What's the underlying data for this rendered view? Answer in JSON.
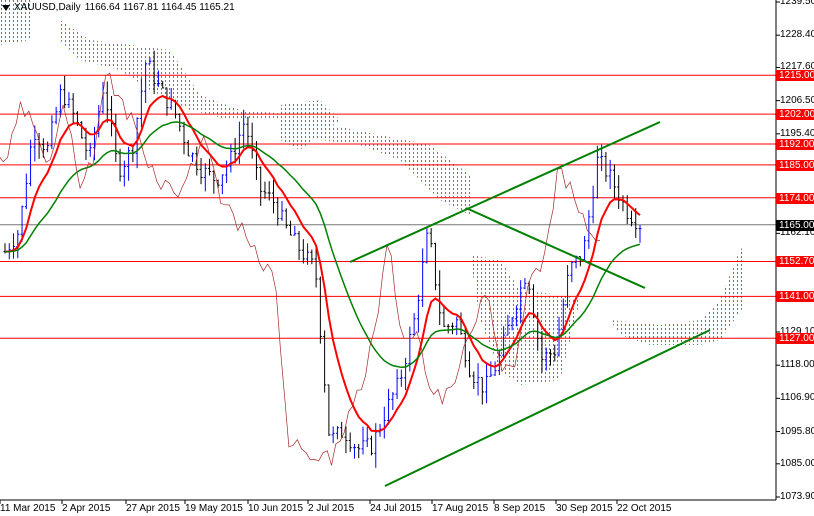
{
  "header": {
    "symbol": "XAUUSD,Daily",
    "ohlc": "1166.64 1167.81 1164.45 1165.21"
  },
  "colors": {
    "bull": "#0000ff",
    "bear": "#000000",
    "level": "#ff0000",
    "trend": "#008000",
    "kijun": "#ff0000",
    "current": "#000000"
  },
  "chart_data": {
    "type": "candlestick",
    "title": "XAUUSD,Daily",
    "ylim": [
      1073.9,
      1239.5
    ],
    "y_ticks": [
      "1239.50",
      "1228.40",
      "1217.60",
      "1206.50",
      "1195.40",
      "1162.10",
      "1129.10",
      "1118.00",
      "1106.90",
      "1095.80",
      "1085.00",
      "1073.90"
    ],
    "x_ticks": [
      "11 Mar 2015",
      "2 Apr 2015",
      "27 Apr 2015",
      "19 May 2015",
      "10 Jun 2015",
      "2 Jul 2015",
      "24 Jul 2015",
      "17 Aug 2015",
      "8 Sep 2015",
      "30 Sep 2015",
      "22 Oct 2015"
    ],
    "approx_closes": [
      1156,
      1163,
      1197,
      1190,
      1210,
      1200,
      1187,
      1212,
      1183,
      1190,
      1220,
      1210,
      1203,
      1190,
      1183,
      1180,
      1187,
      1200,
      1177,
      1173,
      1163,
      1156,
      1150,
      1093,
      1096,
      1090,
      1091,
      1103,
      1113,
      1133,
      1163,
      1130,
      1133,
      1116,
      1110,
      1120,
      1136,
      1150,
      1120,
      1123,
      1150,
      1156,
      1187,
      1180,
      1170,
      1165.21
    ],
    "levels": [
      "1215.00",
      "1202.00",
      "1192.00",
      "1185.00",
      "1174.00",
      "1152.70",
      "1141.00",
      "1127.00"
    ],
    "current_price": "1165.00"
  }
}
